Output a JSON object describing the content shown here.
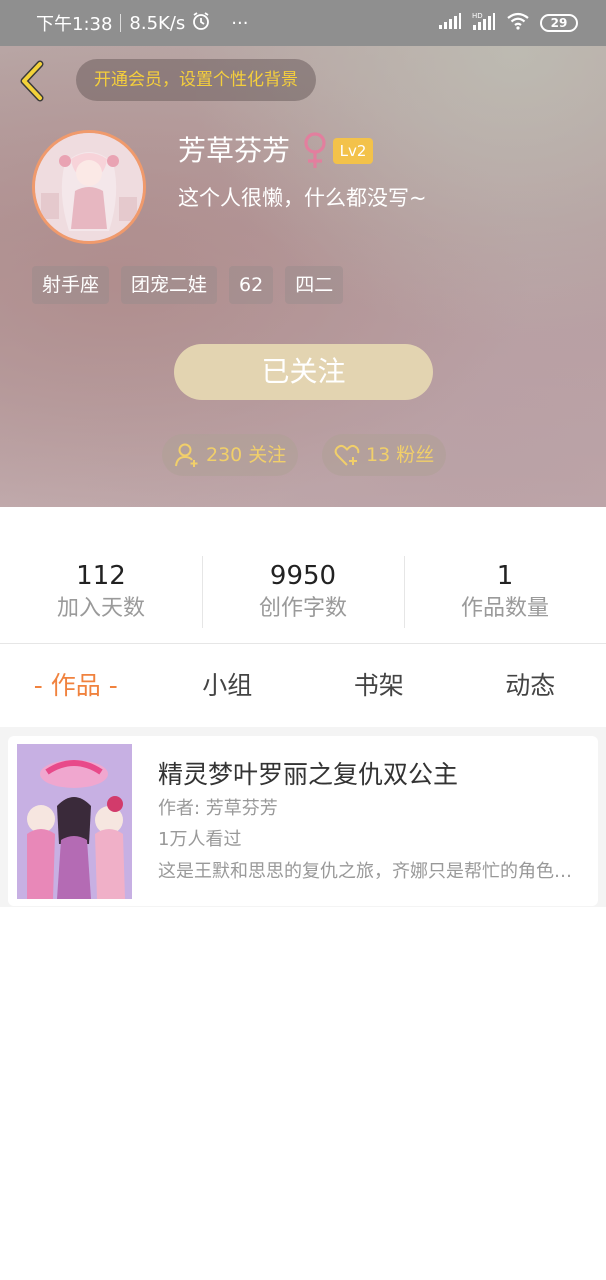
{
  "status_bar": {
    "time": "下午1:38",
    "speed": "8.5K/s",
    "more": "···",
    "battery": "29"
  },
  "header": {
    "vip_prompt": "开通会员，设置个性化背景",
    "username": "芳草芬芳",
    "level": "Lv2",
    "bio": "这个人很懒，什么都没写~",
    "tags": [
      "射手座",
      "团宠二娃",
      "62",
      "四二"
    ],
    "follow_button": "已关注",
    "following": "230 关注",
    "fans": "13 粉丝"
  },
  "stats": [
    {
      "value": "112",
      "label": "加入天数"
    },
    {
      "value": "9950",
      "label": "创作字数"
    },
    {
      "value": "1",
      "label": "作品数量"
    }
  ],
  "tabs": [
    "- 作品 -",
    "小组",
    "书架",
    "动态"
  ],
  "works": [
    {
      "title": "精灵梦叶罗丽之复仇双公主",
      "author": "作者: 芳草芬芳",
      "views": "1万人看过",
      "description": "这是王默和思思的复仇之旅，齐娜只是帮忙的角色…"
    }
  ],
  "colors": {
    "accent": "#f0823e",
    "follow_button": "#e3d4b1",
    "level_badge": "#f3c24a",
    "vip_text": "#f5cf3c"
  }
}
